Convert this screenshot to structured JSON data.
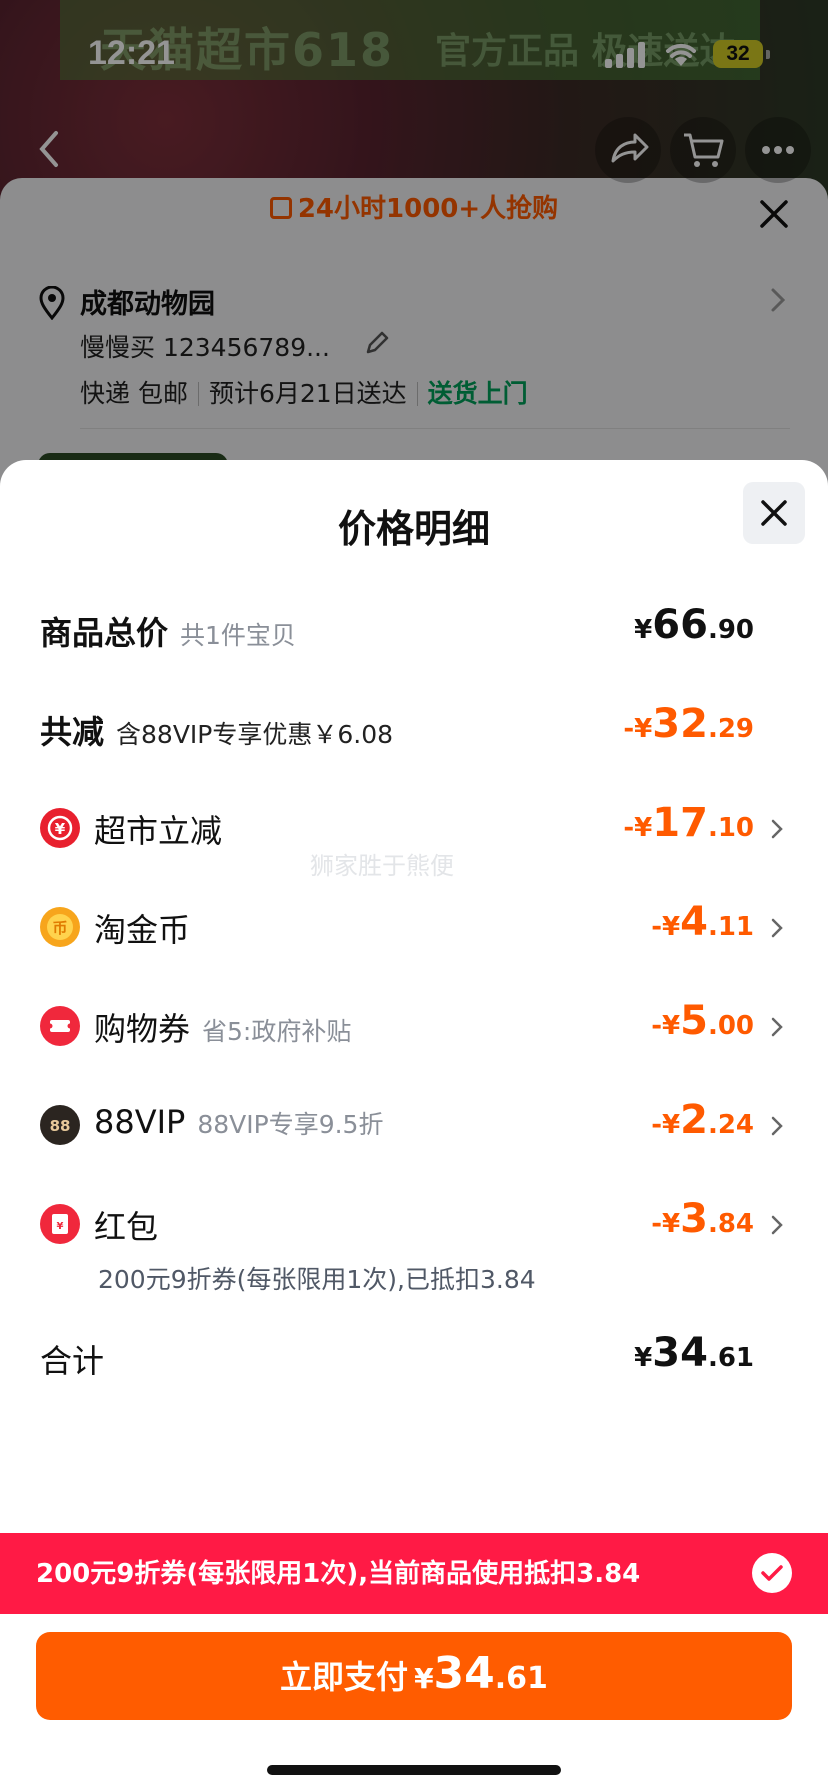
{
  "status_bar": {
    "time": "12:21",
    "battery": "32"
  },
  "background": {
    "banner_text": "天猫超市618",
    "banner_sub": "官方正品 极速送达",
    "promo": "24小时1000+人抢购",
    "address_name": "成都动物园",
    "address_contact": "慢慢买 123456789...",
    "delivery_method": "快递 包邮",
    "delivery_eta": "预计6月21日送达",
    "delivery_tag": "送货上门"
  },
  "modal": {
    "title": "价格明细",
    "total_goods": {
      "label": "商品总价",
      "sub": "共1件宝贝",
      "currency": "¥",
      "int": "66",
      "dec": ".90"
    },
    "total_discount": {
      "label": "共减",
      "sub": "含88VIP专享优惠￥6.08",
      "sign": "-¥",
      "int": "32",
      "dec": ".29"
    },
    "items": [
      {
        "icon": "supermarket-discount-icon",
        "label": "超市立减",
        "sub": "",
        "sign": "-¥",
        "int": "17",
        "dec": ".10"
      },
      {
        "icon": "gold-coin-icon",
        "label": "淘金币",
        "sub": "",
        "sign": "-¥",
        "int": "4",
        "dec": ".11"
      },
      {
        "icon": "coupon-icon",
        "label": "购物券",
        "sub": "省5:政府补贴",
        "sign": "-¥",
        "int": "5",
        "dec": ".00"
      },
      {
        "icon": "88vip-icon",
        "label": "88VIP",
        "sub": "88VIP专享9.5折",
        "sign": "-¥",
        "int": "2",
        "dec": ".24"
      },
      {
        "icon": "red-packet-icon",
        "label": "红包",
        "sub": "",
        "sign": "-¥",
        "int": "3",
        "dec": ".84"
      }
    ],
    "red_packet_note": "200元9折券(每张限用1次),已抵扣3.84",
    "grand_total": {
      "label": "合计",
      "currency": "¥",
      "int": "34",
      "dec": ".61"
    },
    "watermark": "狮家胜于熊便",
    "banner": "200元9折券(每张限用1次),当前商品使用抵扣3.84",
    "pay_button": {
      "label": "立即支付",
      "currency": "¥",
      "int": "34",
      "dec": ".61"
    }
  },
  "colors": {
    "accent": "#ff5a00",
    "banner": "#ff1a45",
    "pay_button": "#ff5c00"
  }
}
